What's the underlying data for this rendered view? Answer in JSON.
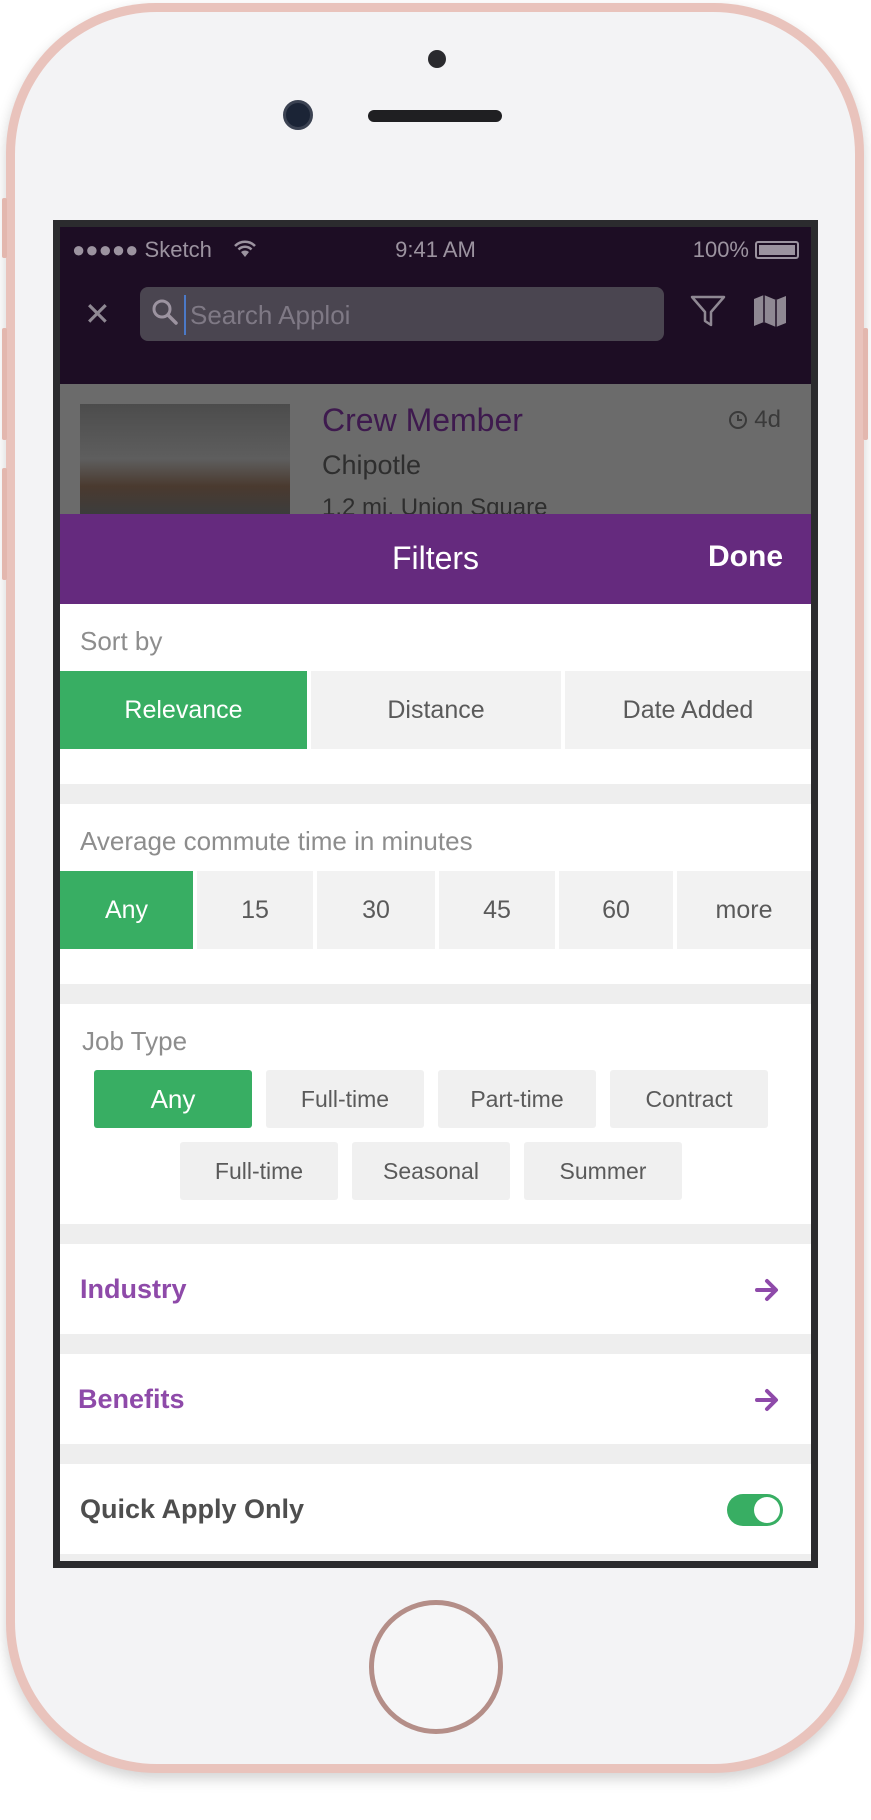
{
  "status_bar": {
    "carrier": "●●●●● Sketch",
    "time": "9:41 AM",
    "battery": "100%"
  },
  "search": {
    "placeholder": "Search Apploi"
  },
  "background_job": {
    "title": "Crew Member",
    "company": "Chipotle",
    "location": "1.2 mi, Union Square",
    "age": "4d"
  },
  "filters": {
    "title": "Filters",
    "done_label": "Done",
    "sort_by": {
      "label": "Sort by",
      "options": [
        "Relevance",
        "Distance",
        "Date Added"
      ],
      "selected": "Relevance"
    },
    "commute": {
      "label": "Average commute time in minutes",
      "options": [
        "Any",
        "15",
        "30",
        "45",
        "60",
        "more"
      ],
      "selected": "Any"
    },
    "job_type": {
      "label": "Job Type",
      "options": [
        "Any",
        "Full-time",
        "Part-time",
        "Contract",
        "Full-time",
        "Seasonal",
        "Summer"
      ],
      "selected": "Any"
    },
    "industry_label": "Industry",
    "benefits_label": "Benefits",
    "quick_apply": {
      "label": "Quick Apply Only",
      "enabled": true
    }
  },
  "colors": {
    "accent_purple": "#652a7e",
    "link_purple": "#8e4aa9",
    "active_green": "#38ae63"
  },
  "icons": [
    "close-icon",
    "search-icon",
    "filter-icon",
    "map-icon",
    "clock-icon",
    "arrow-right-icon",
    "wifi-icon",
    "battery-icon"
  ]
}
